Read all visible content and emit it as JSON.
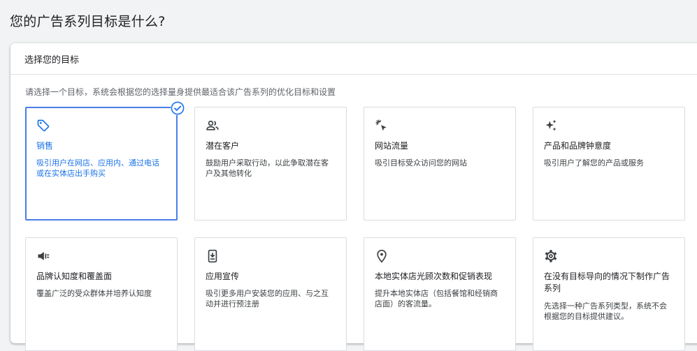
{
  "page_title": "您的广告系列目标是什么?",
  "panel_title": "选择您的目标",
  "instruction": "请选择一个目标，系统会根据您的选择量身提供最适合该广告系列的优化目标和设置",
  "accent_color": "#1a73e8",
  "cards": [
    {
      "icon": "tag-icon",
      "title": "销售",
      "desc": "吸引用户在网店、应用内、通过电话或在实体店出手购买",
      "selected": true
    },
    {
      "icon": "users-icon",
      "title": "潜在客户",
      "desc": "鼓励用户采取行动，以此争取潜在客户及其他转化",
      "selected": false
    },
    {
      "icon": "click-icon",
      "title": "网站流量",
      "desc": "吸引目标受众访问您的网站",
      "selected": false
    },
    {
      "icon": "sparkle-icon",
      "title": "产品和品牌钟意度",
      "desc": "吸引用户了解您的产品或服务",
      "selected": false
    },
    {
      "icon": "megaphone-icon",
      "title": "品牌认知度和覆盖面",
      "desc": "覆盖广泛的受众群体并培养认知度",
      "selected": false
    },
    {
      "icon": "phone-download-icon",
      "title": "应用宣传",
      "desc": "吸引更多用户安装您的应用、与之互动并进行预注册",
      "selected": false
    },
    {
      "icon": "location-pin-icon",
      "title": "本地实体店光顾次数和促销表现",
      "desc": "提升本地实体店（包括餐馆和经销商店面）的客流量。",
      "selected": false
    },
    {
      "icon": "gear-icon",
      "title": "在没有目标导向的情况下制作广告系列",
      "desc": "先选择一种广告系列类型，系统不会根据您的目标提供建议。",
      "selected": false
    }
  ]
}
